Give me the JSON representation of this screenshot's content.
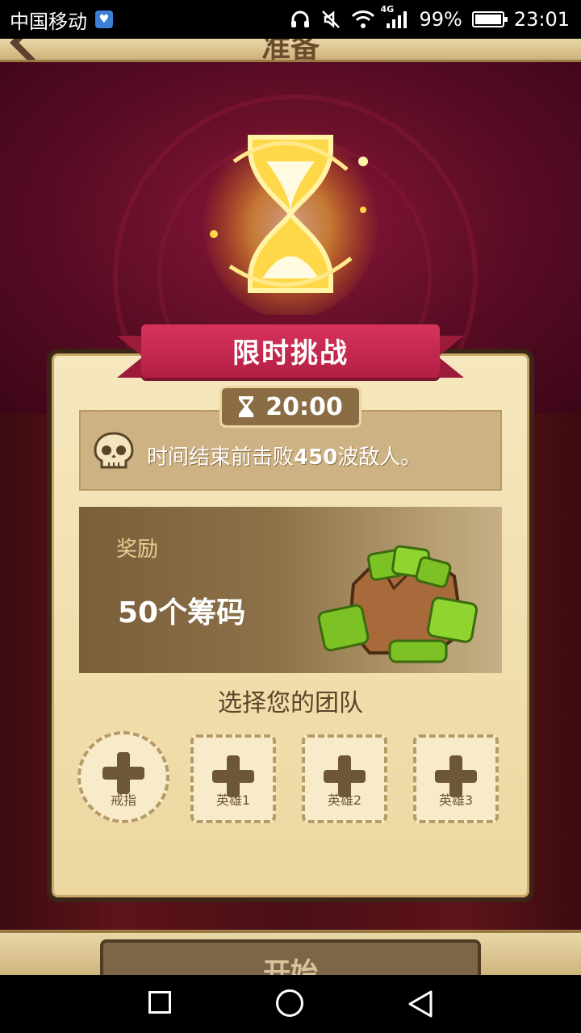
{
  "status_bar": {
    "carrier": "中国移动",
    "network": "4G",
    "battery": "99%",
    "battery_level": 0.99,
    "time": "23:01",
    "icons": [
      "health-app-icon",
      "headphones-icon",
      "mute-icon",
      "wifi-icon",
      "signal-icon",
      "battery-icon"
    ]
  },
  "header": {
    "title": "准备"
  },
  "challenge": {
    "banner_title": "限时挑战",
    "timer": "20:00",
    "goal_prefix": "时间结束前击败",
    "goal_number": "450",
    "goal_suffix": "波敌人。"
  },
  "reward": {
    "label": "奖励",
    "amount_number": "50",
    "amount_text": "个筹码"
  },
  "team": {
    "title": "选择您的团队",
    "slots": [
      {
        "label": "戒指"
      },
      {
        "label": "英雄1"
      },
      {
        "label": "英雄2"
      },
      {
        "label": "英雄3"
      }
    ]
  },
  "actions": {
    "start_label": "开始"
  },
  "colors": {
    "banner": "#c92a50",
    "card": "#f2e2b4",
    "accent_green": "#7cc225",
    "stage": "#6a0f2c"
  }
}
